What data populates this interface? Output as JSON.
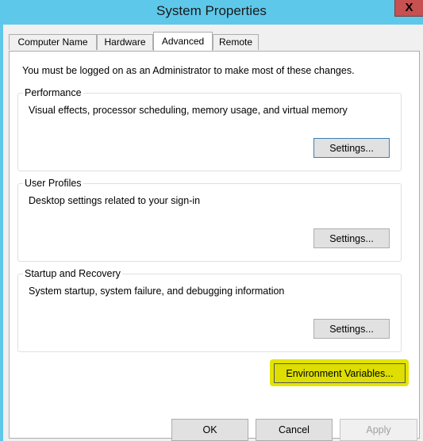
{
  "window": {
    "title": "System Properties",
    "close_glyph": "X"
  },
  "tabs": [
    {
      "label": "Computer Name",
      "active": false
    },
    {
      "label": "Hardware",
      "active": false
    },
    {
      "label": "Advanced",
      "active": true
    },
    {
      "label": "Remote",
      "active": false
    }
  ],
  "advanced": {
    "notice": "You must be logged on as an Administrator to make most of these changes.",
    "groups": [
      {
        "label": "Performance",
        "description": "Visual effects, processor scheduling, memory usage, and virtual memory",
        "button": "Settings..."
      },
      {
        "label": "User Profiles",
        "description": "Desktop settings related to your sign-in",
        "button": "Settings..."
      },
      {
        "label": "Startup and Recovery",
        "description": "System startup, system failure, and debugging information",
        "button": "Settings..."
      }
    ],
    "env_button": "Environment Variables..."
  },
  "footer": {
    "ok": "OK",
    "cancel": "Cancel",
    "apply": "Apply"
  },
  "colors": {
    "titlebar": "#5ec8ea",
    "close": "#c75050",
    "highlight": "#e4e400"
  }
}
